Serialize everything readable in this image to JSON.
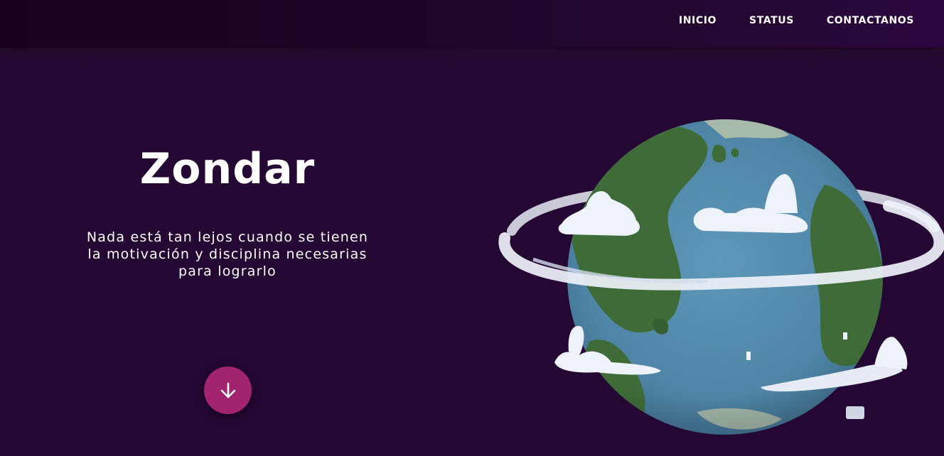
{
  "nav": {
    "items": [
      {
        "label": "INICIO"
      },
      {
        "label": "STATUS"
      },
      {
        "label": "CONTACTANOS"
      }
    ]
  },
  "hero": {
    "title": "Zondar",
    "subtitle": "Nada está tan lejos cuando se tienen la motivación y disciplina necesarias para lograrlo",
    "scroll_icon": "arrow-down-icon",
    "illustration": "planet-with-cloud-rings"
  },
  "colors": {
    "background": "#250733",
    "button": "#a3246e",
    "ocean": "#5288a8",
    "land": "#3d6b38",
    "clouds": "#eef2fa"
  }
}
